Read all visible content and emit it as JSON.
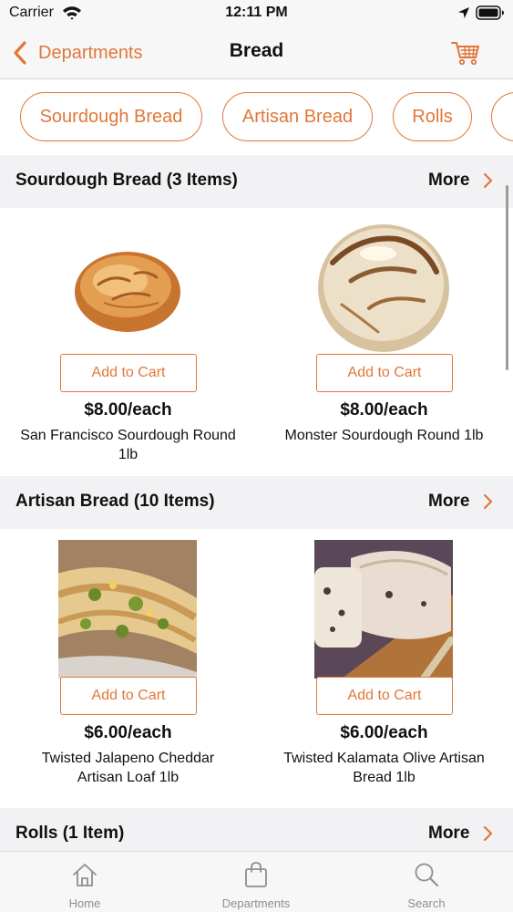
{
  "status_bar": {
    "carrier": "Carrier",
    "time": "12:11 PM"
  },
  "nav": {
    "back_label": "Departments",
    "title": "Bread"
  },
  "chips": [
    {
      "label": "Sourdough Bread"
    },
    {
      "label": "Artisan Bread"
    },
    {
      "label": "Rolls"
    }
  ],
  "sections": [
    {
      "title": "Sourdough Bread (3 Items)",
      "more_label": "More",
      "products": [
        {
          "button_label": "Add to Cart",
          "price": "$8.00/each",
          "name": "San Francisco Sourdough Round 1lb"
        },
        {
          "button_label": "Add to Cart",
          "price": "$8.00/each",
          "name": "Monster Sourdough Round 1lb"
        }
      ]
    },
    {
      "title": "Artisan Bread (10 Items)",
      "more_label": "More",
      "products": [
        {
          "button_label": "Add to Cart",
          "price": "$6.00/each",
          "name": "Twisted Jalapeno Cheddar Artisan Loaf 1lb"
        },
        {
          "button_label": "Add to Cart",
          "price": "$6.00/each",
          "name": "Twisted Kalamata Olive Artisan Bread 1lb"
        }
      ]
    },
    {
      "title": "Rolls (1 Item)",
      "more_label": "More"
    }
  ],
  "tab_bar": {
    "items": [
      {
        "label": "Home",
        "icon": "home-icon"
      },
      {
        "label": "Departments",
        "icon": "shopping-bag-icon"
      },
      {
        "label": "Search",
        "icon": "search-icon"
      }
    ]
  },
  "colors": {
    "accent": "#e0773a",
    "section_background": "#f2f2f4",
    "bar_background": "#f7f7f7",
    "tab_inactive": "#8e8e93"
  }
}
